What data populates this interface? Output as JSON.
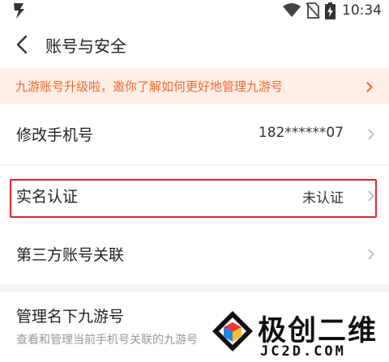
{
  "status_bar": {
    "time": "10:34"
  },
  "header": {
    "title": "账号与安全"
  },
  "banner": {
    "text": "九游账号升级啦，邀你了解如何更好地管理九游号"
  },
  "rows": [
    {
      "label": "修改手机号",
      "value": "182******07"
    },
    {
      "label": "实名认证",
      "value": "未认证"
    },
    {
      "label": "第三方账号关联",
      "value": ""
    }
  ],
  "bottom": {
    "label": "管理名下九游号",
    "desc": "查看和管理当前手机号关联的九游号"
  },
  "watermark": {
    "title": "极创二维",
    "sub": "JC2D.COM"
  },
  "colors": {
    "accent": "#ef6a33",
    "banner_bg": "#fdeee6",
    "highlight": "#e0262f"
  }
}
